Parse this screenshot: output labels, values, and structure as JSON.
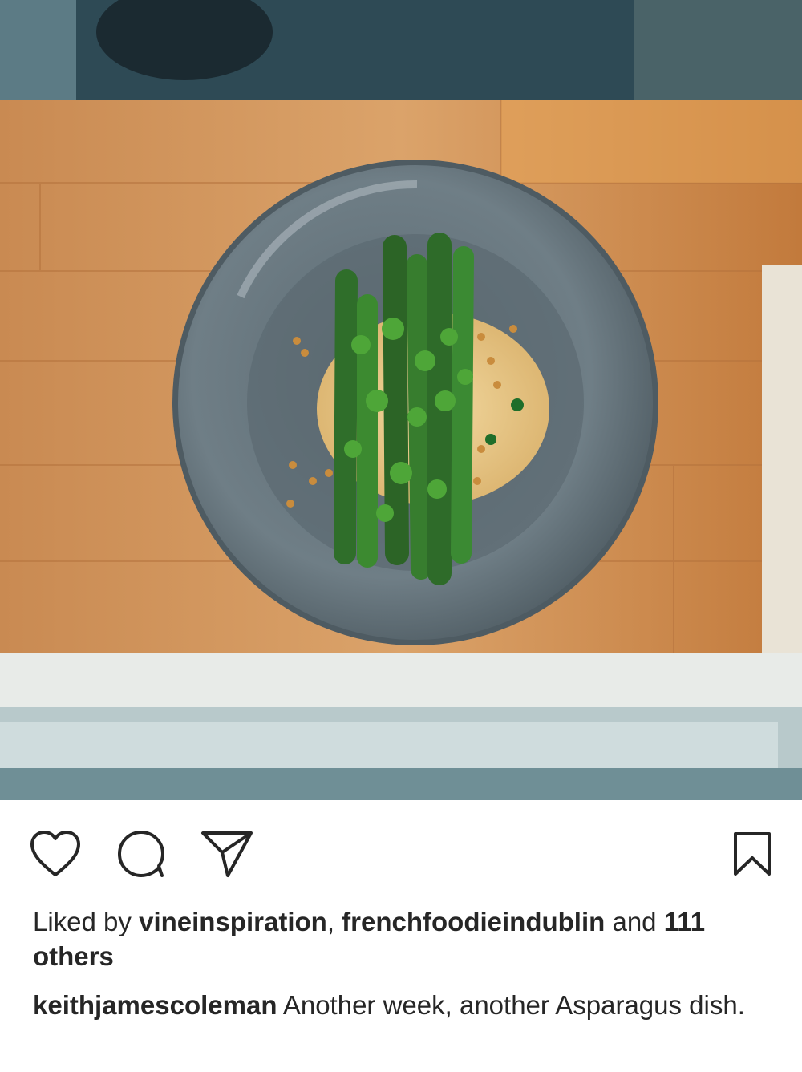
{
  "post": {
    "image_description": "",
    "actions": {
      "like": "heart-icon",
      "comment": "comment-icon",
      "share": "paper-plane-icon",
      "save": "bookmark-icon"
    },
    "likes": {
      "prefix": "Liked by",
      "user1": "vineinspiration",
      "separator": ",",
      "user2": "frenchfoodieindublin",
      "conjunction": "and",
      "others": "111 others"
    },
    "caption": {
      "username": "keithjamescoleman",
      "text": "Another week, another Asparagus dish."
    }
  }
}
